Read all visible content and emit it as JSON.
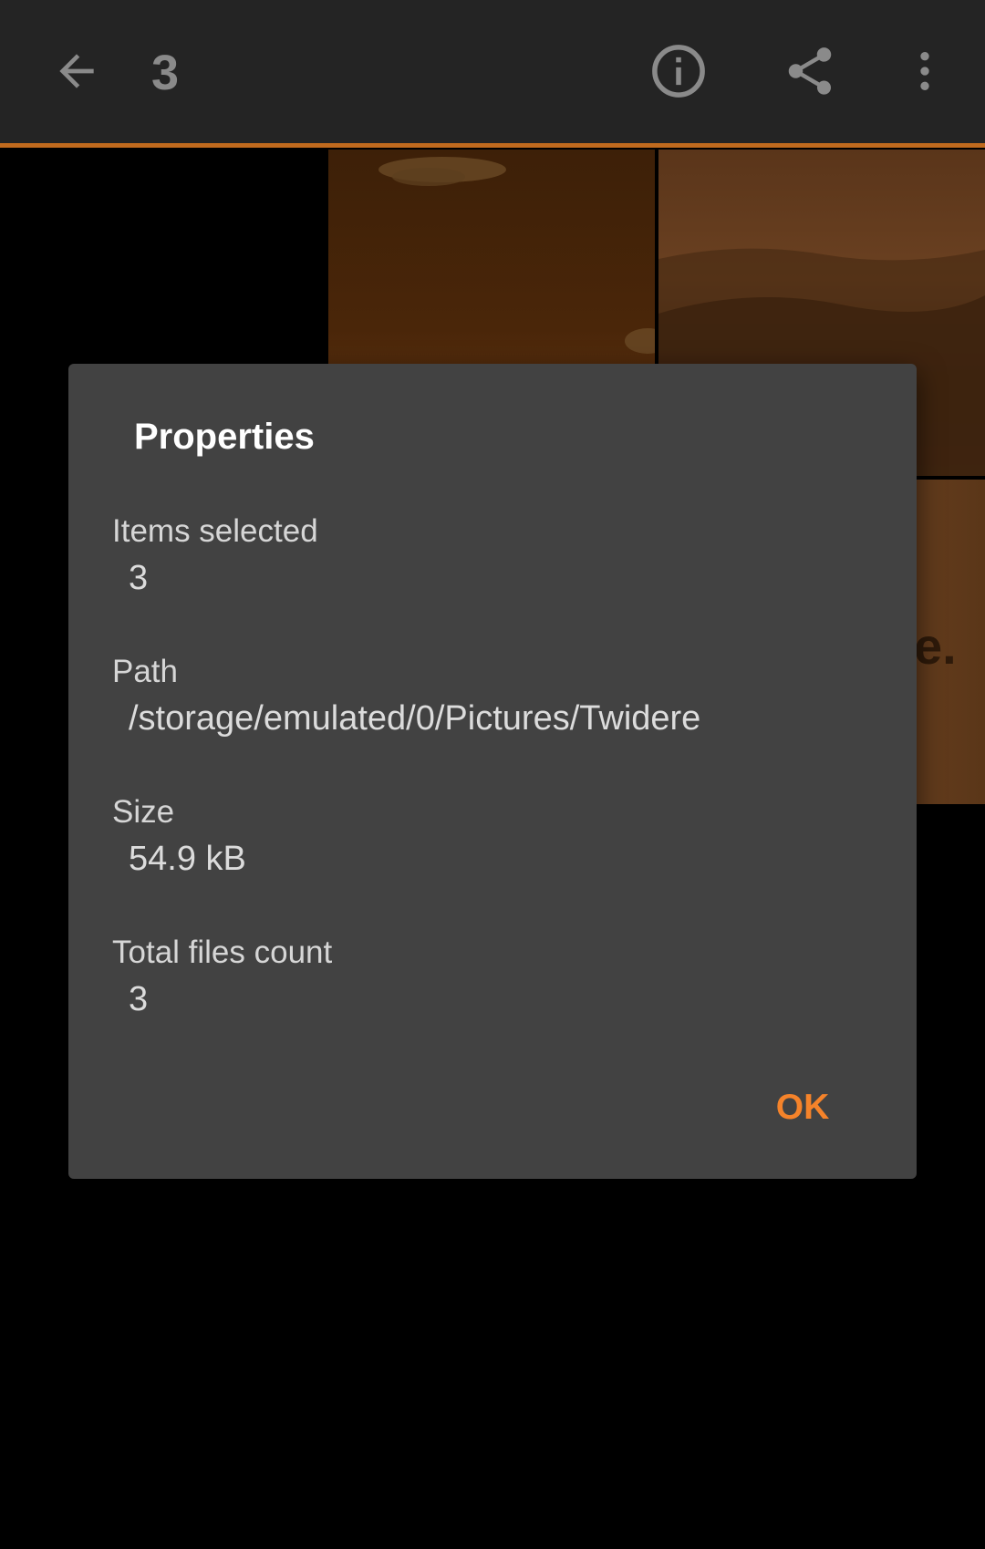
{
  "toolbar": {
    "back_icon": "arrow-back-icon",
    "selection_count": "3",
    "info_icon": "info-icon",
    "share_icon": "share-icon",
    "more_icon": "more-vert-icon"
  },
  "colors": {
    "toolbar_bg": "#242424",
    "accent": "#f5832a",
    "dialog_bg": "#424242"
  },
  "thumbnails": {
    "partial_text": "e."
  },
  "dialog": {
    "title": "Properties",
    "items_selected_label": "Items selected",
    "items_selected_value": "3",
    "path_label": "Path",
    "path_value": "/storage/emulated/0/Pictures/Twidere",
    "size_label": "Size",
    "size_value": "54.9 kB",
    "total_files_label": "Total files count",
    "total_files_value": "3",
    "ok_label": "OK"
  }
}
